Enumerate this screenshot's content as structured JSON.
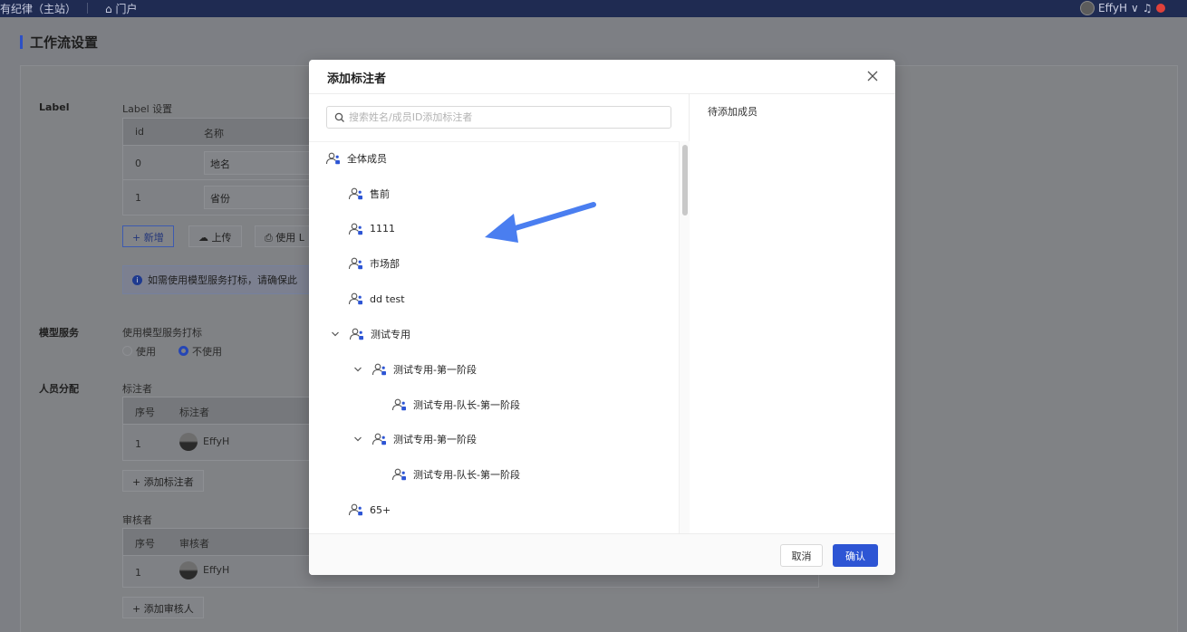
{
  "topbar": {
    "site_name": "有纪律（主站）",
    "home_label": "门户",
    "user_name": "EffyH"
  },
  "page": {
    "title": "工作流设置",
    "sections": {
      "label": "Label",
      "label_setting": "Label 设置",
      "model_service": "模型服务",
      "model_hint": "使用模型服务打标",
      "model_use": "使用",
      "model_not_use": "不使用",
      "staff": "人员分配",
      "annotator": "标注者",
      "reviewer": "审核者"
    },
    "label_table": {
      "headers": [
        "id",
        "名称"
      ],
      "rows": [
        {
          "id": "0",
          "name": "地名"
        },
        {
          "id": "1",
          "name": "省份"
        }
      ]
    },
    "label_buttons": {
      "add": "+ 新增",
      "upload": "上传",
      "use": "使用 L"
    },
    "alert_text": "如需使用模型服务打标，请确保此",
    "annotator_table": {
      "headers": [
        "序号",
        "标注者"
      ],
      "rows": [
        {
          "no": "1",
          "name": "EffyH"
        }
      ],
      "add_button": "+ 添加标注者"
    },
    "reviewer_table": {
      "headers": [
        "序号",
        "审核者"
      ],
      "rows": [
        {
          "no": "1",
          "name": "EffyH"
        }
      ],
      "add_button": "+ 添加审核人"
    }
  },
  "modal": {
    "title": "添加标注者",
    "search_placeholder": "搜索姓名/成员ID添加标注者",
    "pending_title": "待添加成员",
    "tree": [
      {
        "label": "全体成员",
        "expand": "none"
      },
      {
        "label": "售前",
        "expand": "none"
      },
      {
        "label": "1111",
        "expand": "none"
      },
      {
        "label": "市场部",
        "expand": "none"
      },
      {
        "label": "dd test",
        "expand": "none"
      },
      {
        "label": "测试专用",
        "expand": "expanded"
      },
      {
        "label": "测试专用-第一阶段",
        "expand": "expanded"
      },
      {
        "label": "测试专用-队长-第一阶段",
        "expand": "none"
      },
      {
        "label": "测试专用-第一阶段",
        "expand": "expanded"
      },
      {
        "label": "测试专用-队长-第一阶段",
        "expand": "none"
      },
      {
        "label": "65+",
        "expand": "none"
      }
    ],
    "cancel_label": "取消",
    "confirm_label": "确认"
  },
  "colors": {
    "primary": "#2d55d4",
    "arrow": "#4a7ef0",
    "group_icon_accent": "#2d55d4"
  }
}
